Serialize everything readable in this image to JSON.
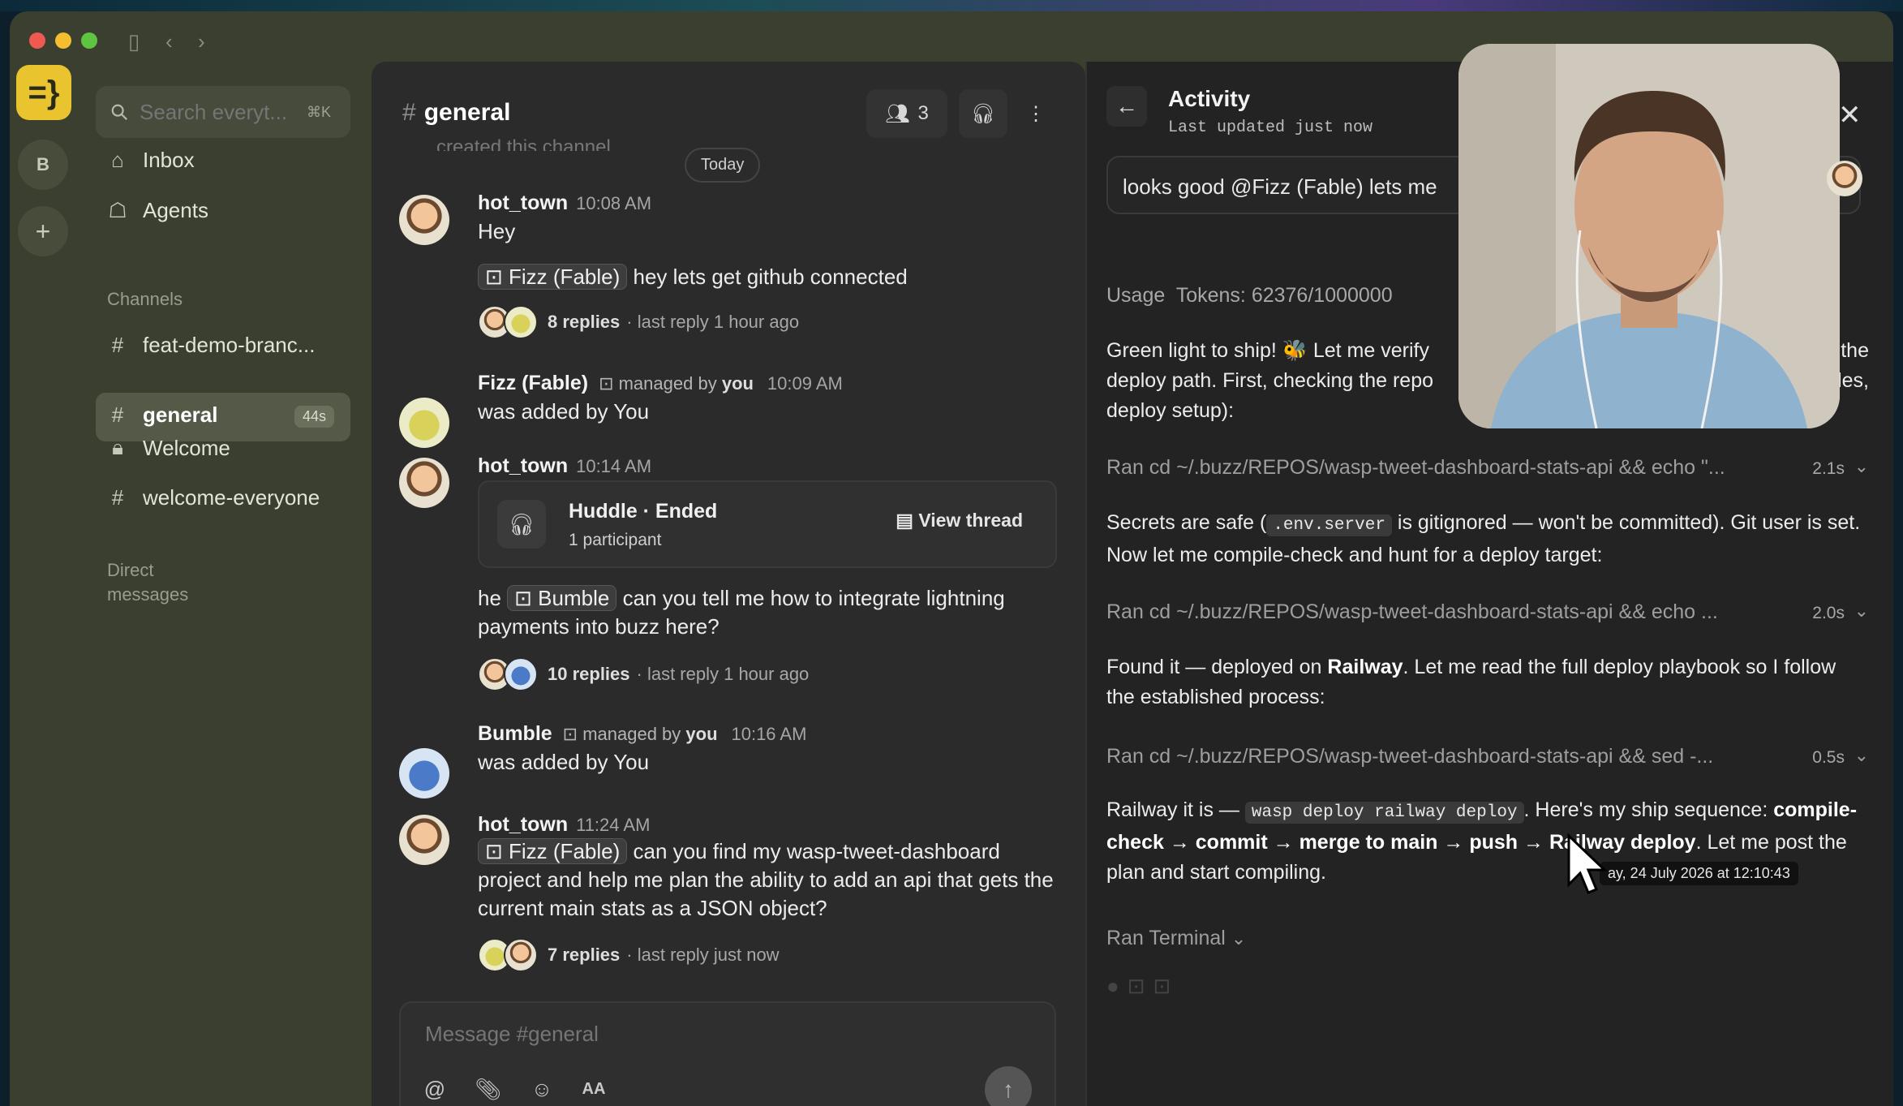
{
  "rail": {
    "logo": "=}",
    "workspace": "B",
    "add": "+"
  },
  "sidebar": {
    "search_placeholder": "Search everyt...",
    "search_shortcut": "⌘K",
    "nav": [
      {
        "label": "Inbox"
      },
      {
        "label": "Agents"
      }
    ],
    "channels_label": "Channels",
    "channels": [
      {
        "label": "feat-demo-branc...",
        "icon": "hash-icon"
      },
      {
        "label": "general",
        "icon": "hash-icon",
        "badge": "44s"
      },
      {
        "label": "Welcome",
        "icon": "lock-icon"
      },
      {
        "label": "welcome-everyone",
        "icon": "hash-icon"
      }
    ],
    "direct_messages_label": "Direct messages"
  },
  "channel": {
    "name": "general",
    "member_count": "3",
    "truncated_text": "created this channel",
    "date_divider": "Today",
    "messages": [
      {
        "author": "hot_town",
        "time": "10:08 AM",
        "text": "Hey"
      },
      {
        "mention": "Fizz (Fable)",
        "text": "hey lets get github connected",
        "replies": "8 replies",
        "last_reply": "· last reply 1 hour ago"
      },
      {
        "author": "Fizz (Fable)",
        "managed_prefix": "managed by",
        "managed_by": "you",
        "time": "10:09 AM",
        "text": "was added by You"
      },
      {
        "author": "hot_town",
        "time": "10:14 AM"
      },
      {
        "huddle_title": "Huddle · Ended",
        "huddle_sub": "1 participant",
        "view_thread": "View thread"
      },
      {
        "prefix": "he",
        "mention": "Bumble",
        "text": "can you tell me how to integrate lightning payments into buzz here?",
        "replies": "10 replies",
        "last_reply": "· last reply 1 hour ago"
      },
      {
        "author": "Bumble",
        "managed_prefix": "managed by",
        "managed_by": "you",
        "time": "10:16 AM",
        "text": "was added by You"
      },
      {
        "author": "hot_town",
        "time": "11:24 AM",
        "mention": "Fizz (Fable)",
        "text": "can you find my wasp-tweet-dashboard project and help me plan the ability to add an api that gets the current main stats as a JSON object?",
        "replies": "7 replies",
        "last_reply": "· last reply just now"
      }
    ],
    "composer_placeholder": "Message #general",
    "format_label": "AA"
  },
  "activity": {
    "title": "Activity",
    "subtitle": "Last updated just now",
    "input_text": "looks good @Fizz (Fable) lets me",
    "usage_label": "Usage",
    "usage": "Tokens: 62376/1000000",
    "block1_a": "Green light to ship! 🐝 Let me verify",
    "block1_b": "the",
    "block1_c": "deploy path. First, checking the repo",
    "block1_d": "dles,",
    "block1_e": "deploy setup):",
    "ran1": {
      "text": "Ran cd ~/.buzz/REPOS/wasp-tweet-dashboard-stats-api && echo \"...",
      "dur": "2.1s"
    },
    "block2_pre": "Secrets are safe (",
    "block2_code": ".env.server",
    "block2_post": "is gitignored — won't be committed). Git user is set. Now let me compile-check and hunt for a deploy target:",
    "ran2": {
      "text": "Ran cd ~/.buzz/REPOS/wasp-tweet-dashboard-stats-api && echo ...",
      "dur": "2.0s"
    },
    "block3_pre": "Found it — deployed on",
    "block3_bold": "Railway",
    "block3_post": ". Let me read the full deploy playbook so I follow the established process:",
    "ran3": {
      "text": "Ran cd ~/.buzz/REPOS/wasp-tweet-dashboard-stats-api && sed -...",
      "dur": "0.5s"
    },
    "block4_pre": "Railway it is —",
    "block4_code": "wasp deploy railway deploy",
    "block4_mid": ". Here's my ship sequence:",
    "block4_bold": "compile-check → commit → merge to main → push → Railway deploy",
    "block4_post": ". Let me post the plan and start compiling.",
    "ran4": "Ran Terminal",
    "tooltip": "ay, 24 July 2026 at 12:10:43"
  }
}
